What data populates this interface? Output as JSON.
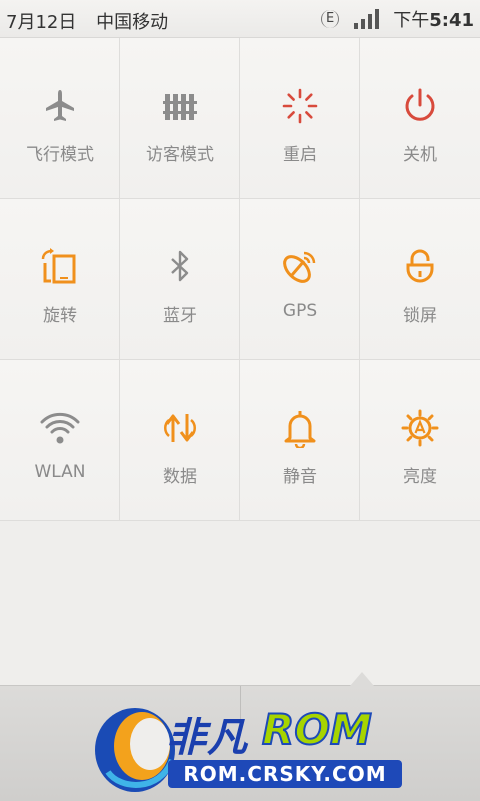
{
  "status_bar": {
    "date": "7月12日",
    "carrier": "中国移动",
    "network_type": "E",
    "time_prefix": "下午",
    "time": "5:41"
  },
  "toggles": [
    {
      "label": "飞行模式",
      "icon": "airplane-icon",
      "color": "#8c8c8c"
    },
    {
      "label": "访客模式",
      "icon": "fence-icon",
      "color": "#8c8c8c"
    },
    {
      "label": "重启",
      "icon": "reboot-icon",
      "color": "#d84a3c"
    },
    {
      "label": "关机",
      "icon": "power-icon",
      "color": "#d84a3c"
    },
    {
      "label": "旋转",
      "icon": "rotate-icon",
      "color": "#f0901c"
    },
    {
      "label": "蓝牙",
      "icon": "bluetooth-icon",
      "color": "#8c8c8c"
    },
    {
      "label": "GPS",
      "icon": "gps-icon",
      "color": "#f0901c"
    },
    {
      "label": "锁屏",
      "icon": "lock-icon",
      "color": "#f0901c"
    },
    {
      "label": "WLAN",
      "icon": "wifi-icon",
      "color": "#8c8c8c"
    },
    {
      "label": "数据",
      "icon": "data-icon",
      "color": "#f0901c"
    },
    {
      "label": "静音",
      "icon": "bell-icon",
      "color": "#f0901c"
    },
    {
      "label": "亮度",
      "icon": "brightness-icon",
      "color": "#f0901c"
    }
  ],
  "watermark": {
    "brand_cn": "非凡",
    "brand_rom": "ROM",
    "url": "ROM.CRSKY.COM"
  },
  "colors": {
    "accent_orange": "#f0901c",
    "accent_red": "#d84a3c",
    "inactive_gray": "#8c8c8c"
  }
}
